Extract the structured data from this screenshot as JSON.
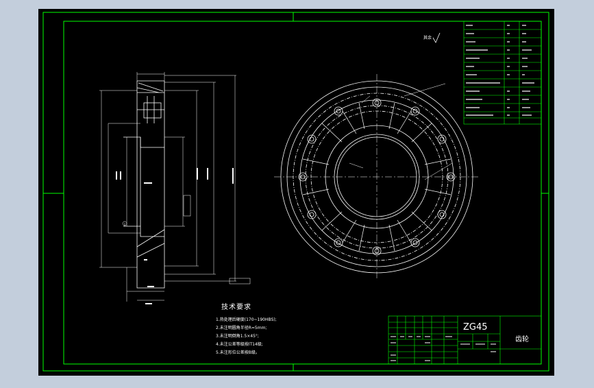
{
  "drawing": {
    "material": "ZG45",
    "part_name": "齿轮",
    "roughness_note": "其余",
    "technical_requirements": {
      "title": "技术要求",
      "items": [
        "1.热处理后硬度(170~190HBS);",
        "2.未注明圆角半径R=5mm;",
        "3.未注明倒角1.5×45°;",
        "4.未注公差等级按IT14级;",
        "5.未注形位公差按B级。"
      ]
    },
    "colors": {
      "frame_bg": "#000000",
      "window_bg": "#c3cedc",
      "outline": "#00ff00",
      "line": "#ffffff",
      "dimension": "#ffffff"
    }
  }
}
